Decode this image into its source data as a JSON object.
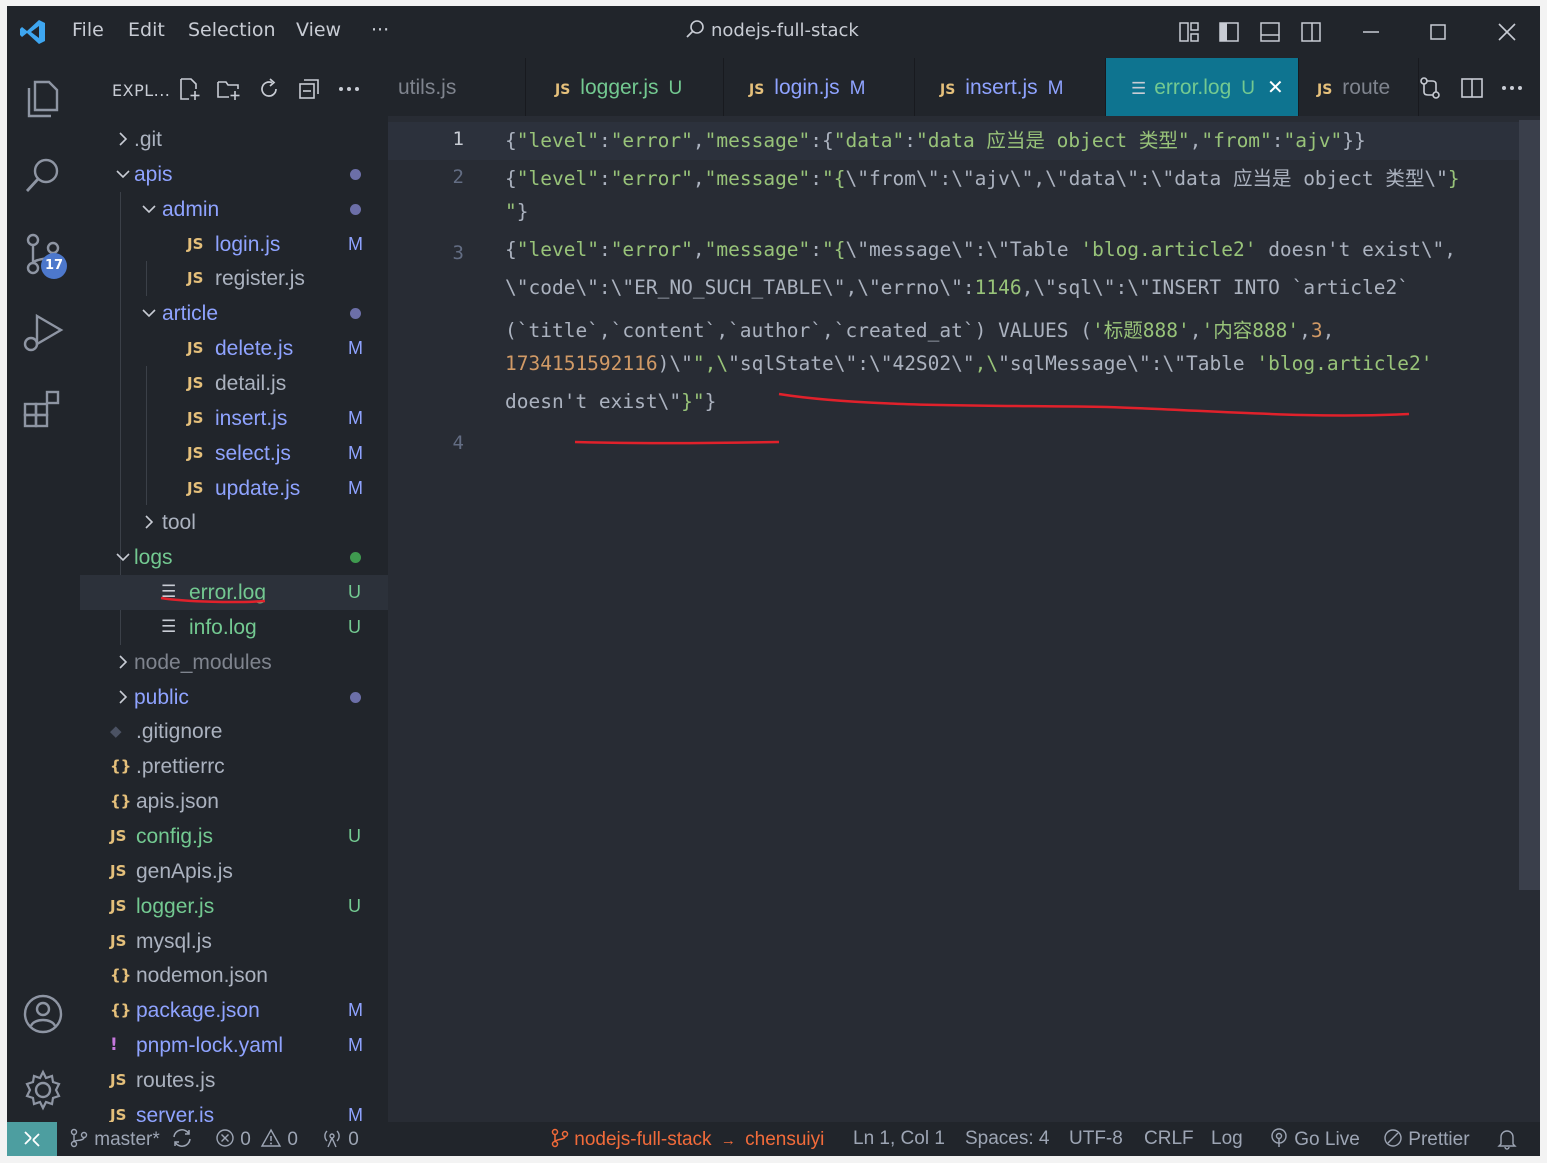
{
  "window": {
    "title": "nodejs-full-stack",
    "menu": [
      "File",
      "Edit",
      "Selection",
      "View",
      "···"
    ]
  },
  "activity_bar": {
    "source_control_badge": "17",
    "icons": [
      "files-icon",
      "search-icon",
      "source-control-icon",
      "run-debug-icon",
      "extensions-icon",
      "account-icon",
      "settings-gear-icon"
    ]
  },
  "sidebar": {
    "title": "EXPL...",
    "tree": [
      {
        "label": ".git",
        "kind": "folder",
        "open": false,
        "depth": 0,
        "color": "#abb2bf"
      },
      {
        "label": "apis",
        "kind": "folder",
        "open": true,
        "depth": 0,
        "color": "#8fa3ff",
        "dot": "#6c6fa8"
      },
      {
        "label": "admin",
        "kind": "folder",
        "open": true,
        "depth": 1,
        "color": "#8fa3ff",
        "dot": "#6c6fa8"
      },
      {
        "label": "login.js",
        "kind": "js",
        "depth": 2,
        "color": "#8fa3ff",
        "status": "M",
        "status_color": "#8fa3ff"
      },
      {
        "label": "register.js",
        "kind": "js",
        "depth": 2,
        "color": "#abb2bf"
      },
      {
        "label": "article",
        "kind": "folder",
        "open": true,
        "depth": 1,
        "color": "#8fa3ff",
        "dot": "#6c6fa8"
      },
      {
        "label": "delete.js",
        "kind": "js",
        "depth": 2,
        "color": "#8fa3ff",
        "status": "M",
        "status_color": "#8fa3ff"
      },
      {
        "label": "detail.js",
        "kind": "js",
        "depth": 2,
        "color": "#abb2bf"
      },
      {
        "label": "insert.js",
        "kind": "js",
        "depth": 2,
        "color": "#8fa3ff",
        "status": "M",
        "status_color": "#8fa3ff"
      },
      {
        "label": "select.js",
        "kind": "js",
        "depth": 2,
        "color": "#8fa3ff",
        "status": "M",
        "status_color": "#8fa3ff"
      },
      {
        "label": "update.js",
        "kind": "js",
        "depth": 2,
        "color": "#8fa3ff",
        "status": "M",
        "status_color": "#8fa3ff"
      },
      {
        "label": "tool",
        "kind": "folder",
        "open": false,
        "depth": 1,
        "color": "#abb2bf"
      },
      {
        "label": "logs",
        "kind": "folder",
        "open": true,
        "depth": 0,
        "color": "#73c991",
        "dot": "#3f9a4f"
      },
      {
        "label": "error.log",
        "kind": "log",
        "depth": 1,
        "color": "#73c991",
        "status": "U",
        "status_color": "#73c991",
        "selected": true
      },
      {
        "label": "info.log",
        "kind": "log",
        "depth": 1,
        "color": "#73c991",
        "status": "U",
        "status_color": "#73c991"
      },
      {
        "label": "node_modules",
        "kind": "folder",
        "open": false,
        "depth": 0,
        "color": "#7f848e"
      },
      {
        "label": "public",
        "kind": "folder",
        "open": false,
        "depth": 0,
        "color": "#8fa3ff",
        "dot": "#6c6fa8"
      },
      {
        "label": ".gitignore",
        "kind": "git",
        "depth": 0,
        "color": "#abb2bf"
      },
      {
        "label": ".prettierrc",
        "kind": "json",
        "depth": 0,
        "color": "#abb2bf"
      },
      {
        "label": "apis.json",
        "kind": "json",
        "depth": 0,
        "color": "#abb2bf"
      },
      {
        "label": "config.js",
        "kind": "js",
        "depth": 0,
        "color": "#73c991",
        "status": "U",
        "status_color": "#73c991"
      },
      {
        "label": "genApis.js",
        "kind": "js",
        "depth": 0,
        "color": "#abb2bf"
      },
      {
        "label": "logger.js",
        "kind": "js",
        "depth": 0,
        "color": "#73c991",
        "status": "U",
        "status_color": "#73c991"
      },
      {
        "label": "mysql.js",
        "kind": "js",
        "depth": 0,
        "color": "#abb2bf"
      },
      {
        "label": "nodemon.json",
        "kind": "json",
        "depth": 0,
        "color": "#abb2bf"
      },
      {
        "label": "package.json",
        "kind": "json",
        "depth": 0,
        "color": "#8fa3ff",
        "status": "M",
        "status_color": "#8fa3ff"
      },
      {
        "label": "pnpm-lock.yaml",
        "kind": "yaml",
        "depth": 0,
        "color": "#8fa3ff",
        "status": "M",
        "status_color": "#8fa3ff"
      },
      {
        "label": "routes.js",
        "kind": "js",
        "depth": 0,
        "color": "#abb2bf"
      },
      {
        "label": "server.js",
        "kind": "js",
        "depth": 0,
        "color": "#8fa3ff",
        "status": "M",
        "status_color": "#8fa3ff"
      }
    ]
  },
  "tabs": [
    {
      "label": "utils.js",
      "kind": "plain",
      "color": "#7f848e",
      "status": ""
    },
    {
      "label": "logger.js",
      "kind": "js",
      "color": "#73c991",
      "status": "U",
      "status_color": "#73c991"
    },
    {
      "label": "login.js",
      "kind": "js",
      "color": "#8fa3ff",
      "status": "M",
      "status_color": "#8fa3ff"
    },
    {
      "label": "insert.js",
      "kind": "js",
      "color": "#8fa3ff",
      "status": "M",
      "status_color": "#8fa3ff"
    },
    {
      "label": "error.log",
      "kind": "log",
      "color": "#73c991",
      "status": "U",
      "status_color": "#73c991",
      "active": true,
      "close": "✕"
    },
    {
      "label": "route",
      "kind": "js",
      "color": "#7f848e",
      "status": ""
    }
  ],
  "editor": {
    "line_numbers": [
      "1",
      "2",
      "3",
      "4"
    ],
    "lines": [
      [
        [
          "p",
          "{"
        ],
        [
          "s",
          "\"level\""
        ],
        [
          "p",
          ":"
        ],
        [
          "s",
          "\"error\""
        ],
        [
          "p",
          ","
        ],
        [
          "s",
          "\"message\""
        ],
        [
          "p",
          ":{"
        ],
        [
          "s",
          "\"data\""
        ],
        [
          "p",
          ":"
        ],
        [
          "s",
          "\"data 应当是 object 类型\""
        ],
        [
          "p",
          ","
        ],
        [
          "s",
          "\"from\""
        ],
        [
          "p",
          ":"
        ],
        [
          "s",
          "\"ajv\""
        ],
        [
          "p",
          "}}"
        ]
      ],
      [
        [
          "p",
          "{"
        ],
        [
          "s",
          "\"level\""
        ],
        [
          "p",
          ":"
        ],
        [
          "s",
          "\"error\""
        ],
        [
          "p",
          ","
        ],
        [
          "s",
          "\"message\""
        ],
        [
          "p",
          ":"
        ],
        [
          "s",
          "\"{"
        ],
        [
          "p",
          "\\\"from\\\":\\\"ajv\\\",\\\"data\\\":\\\"data 应当是 object 类型\\\""
        ],
        [
          "s",
          "}"
        ]
      ],
      [
        [
          "s",
          "\""
        ],
        [
          "p",
          "}"
        ]
      ],
      [
        [
          "p",
          "{"
        ],
        [
          "s",
          "\"level\""
        ],
        [
          "p",
          ":"
        ],
        [
          "s",
          "\"error\""
        ],
        [
          "p",
          ","
        ],
        [
          "s",
          "\"message\""
        ],
        [
          "p",
          ":"
        ],
        [
          "s",
          "\"{"
        ],
        [
          "p",
          "\\\"message\\\":\\\"Table "
        ],
        [
          "s",
          "'blog.article2'"
        ],
        [
          "p",
          " doesn't exist\\\","
        ]
      ],
      [
        [
          "p",
          "\\\"code\\\":\\\"ER_NO_SUCH_TABLE\\\",\\\"errno\\\":"
        ],
        [
          "s",
          "1146"
        ],
        [
          "p",
          ",\\\"sql\\\":\\\"INSERT INTO `article2`"
        ]
      ],
      [
        [
          "p",
          "(`title`,`content`,`author`,`created_at`) VALUES ("
        ],
        [
          "s",
          "'标题888'"
        ],
        [
          "p",
          ","
        ],
        [
          "s",
          "'内容888'"
        ],
        [
          "p",
          ","
        ],
        [
          "n",
          "3"
        ],
        [
          "p",
          ","
        ]
      ],
      [
        [
          "n",
          "1734151592116"
        ],
        [
          "p",
          ")\\\""
        ],
        [
          "s",
          "\",\\"
        ],
        [
          "p",
          "\"sqlState\\\":\\\"42S02\\\""
        ],
        [
          "s",
          ",\\"
        ],
        [
          "p",
          "\"sqlMessage\\\":\\\"Table "
        ],
        [
          "s",
          "'blog.article2'"
        ]
      ],
      [
        [
          "p",
          "doesn't exist\\\""
        ],
        [
          "s",
          "}\""
        ],
        [
          "p",
          "}"
        ]
      ]
    ]
  },
  "statusbar": {
    "branch": "master*",
    "errors": "0",
    "warnings": "0",
    "ports": "0",
    "project": "nodejs-full-stack",
    "arrow": "→",
    "user": "chensuiyi",
    "position": "Ln 1, Col 1",
    "spaces": "Spaces: 4",
    "encoding": "UTF-8",
    "eol": "CRLF",
    "language": "Log",
    "golive": "Go Live",
    "prettier": "Prettier"
  }
}
